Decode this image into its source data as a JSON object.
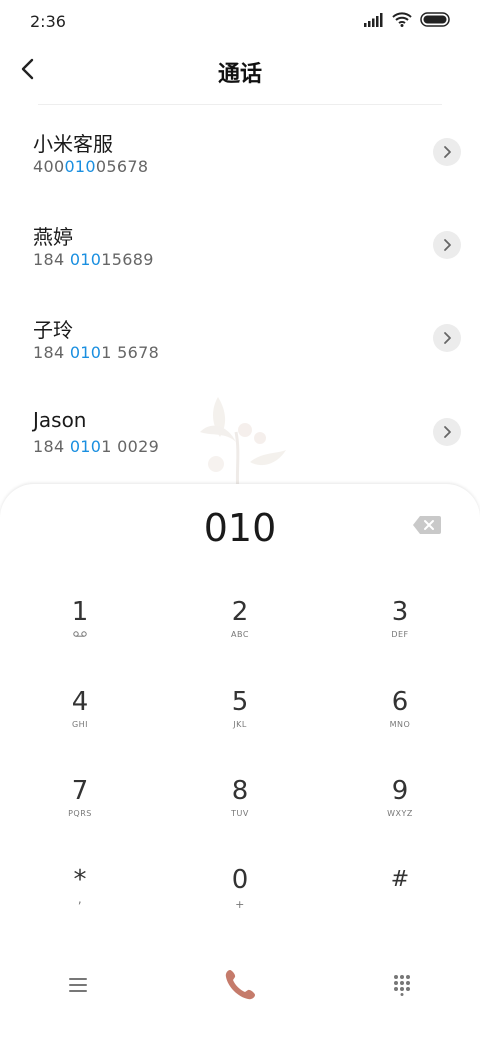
{
  "status_bar": {
    "time": "2:36"
  },
  "header": {
    "title": "通话"
  },
  "contacts": [
    {
      "name": "小米客服",
      "number_pre": "400",
      "number_hl": "010",
      "number_post": "05678"
    },
    {
      "name": "燕婷",
      "number_pre": "184 ",
      "number_hl": "010",
      "number_post": "15689"
    },
    {
      "name": "子玲",
      "number_pre": "184 ",
      "number_hl": "010",
      "number_post": "1 5678"
    },
    {
      "name": "Jason",
      "number_pre": "184 ",
      "number_hl": "010",
      "number_post": "1 0029"
    }
  ],
  "dialer": {
    "input": "010"
  },
  "keypad": [
    {
      "digit": "1",
      "sub": ""
    },
    {
      "digit": "2",
      "sub": "ABC"
    },
    {
      "digit": "3",
      "sub": "DEF"
    },
    {
      "digit": "4",
      "sub": "GHI"
    },
    {
      "digit": "5",
      "sub": "JKL"
    },
    {
      "digit": "6",
      "sub": "MNO"
    },
    {
      "digit": "7",
      "sub": "PQRS"
    },
    {
      "digit": "8",
      "sub": "TUV"
    },
    {
      "digit": "9",
      "sub": "WXYZ"
    },
    {
      "digit": "*",
      "sub": ","
    },
    {
      "digit": "0",
      "sub": "+"
    },
    {
      "digit": "#",
      "sub": ""
    }
  ],
  "colors": {
    "highlight": "#1a8fe0",
    "call": "#c57b6b"
  }
}
